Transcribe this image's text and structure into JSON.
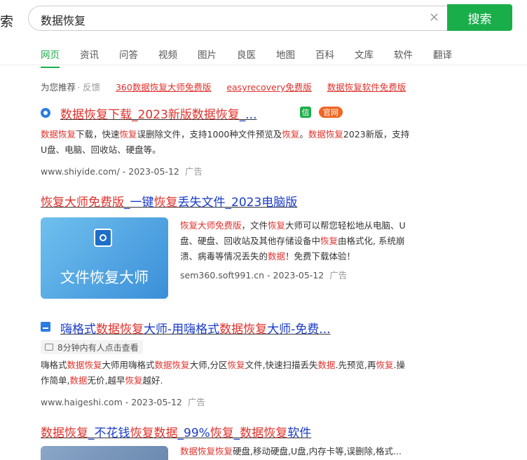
{
  "search": {
    "logo_char": "索",
    "query": "数据恢复",
    "clear_symbol": "×",
    "button_label": "搜索"
  },
  "tabs": [
    "网页",
    "资讯",
    "问答",
    "视频",
    "图片",
    "良医",
    "地图",
    "百科",
    "文库",
    "软件",
    "翻译"
  ],
  "recommend": {
    "label": "为您推荐",
    "feedback": "· 反馈",
    "links": [
      "360数据恢复大师免费版",
      "easyrecovery免费版",
      "数据恢复软件免费版"
    ]
  },
  "results": [
    {
      "title_red": "数据恢复下载_2023新版",
      "title_red2": "数据恢复",
      "title_tail": "_...",
      "badge_xin": "信",
      "badge_official": "官网",
      "snippet_line1_a": "数据恢复",
      "snippet_line1_b": "下载，快速",
      "snippet_line1_c": "恢复",
      "snippet_line1_d": "误删除文件，支持1000种文件预览及",
      "snippet_line1_e": "恢复",
      "snippet_line1_f": "。",
      "snippet_line1_g": "数据恢复",
      "snippet_line1_h": "2023新版，支持",
      "snippet_line2": "U盘、电脑、回收站、硬盘等。",
      "url": "www.shiyide.com/ - 2023-05-12",
      "ad": "广告"
    },
    {
      "title_red": "恢复大师免费版",
      "title_mid": "_一键",
      "title_red2": "恢复",
      "title_tail": "丢失文件_2023电脑版",
      "thumb_text": "文件恢复大师",
      "snippet_l1_a": "恢复大师免费版",
      "snippet_l1_b": "，文件",
      "snippet_l1_c": "恢复",
      "snippet_l1_d": "大师可以帮您轻松地从电脑、U",
      "snippet_l2_a": "盘、硬盘、回收站及其他存储设备中",
      "snippet_l2_b": "恢复",
      "snippet_l2_c": "由格式化, 系统崩",
      "snippet_l3_a": "溃、病毒等情况丢失的",
      "snippet_l3_b": "数据",
      "snippet_l3_c": "！免费下载体验！",
      "url": "sem360.soft991.cn - 2023-05-12",
      "ad": "广告"
    },
    {
      "title_a": "嗨格式",
      "title_red": "数据恢复",
      "title_b": "大师-用嗨格式",
      "title_red2": "数据恢复",
      "title_c": "大师-免费...",
      "clicks": "8分钟内有人点击查看",
      "s1_a": "嗨格式",
      "s1_b": "数据恢复",
      "s1_c": "大师用嗨格式",
      "s1_d": "数据恢复",
      "s1_e": "大师,分区",
      "s1_f": "恢复",
      "s1_g": "文件,快速扫描丢失",
      "s1_h": "数据",
      "s1_i": ".先预览,再",
      "s1_j": "恢复",
      "s1_k": ".操",
      "s2_a": "作简单,",
      "s2_b": "数据",
      "s2_c": "无价,越早",
      "s2_d": "恢复",
      "s2_e": "越好.",
      "url": "www.haigeshi.com - 2023-05-12",
      "ad": "广告"
    },
    {
      "title_red": "数据恢复",
      "title_a": "_不花钱",
      "title_red2": "恢复数据",
      "title_b": "_99%",
      "title_red3": "恢复",
      "title_c": "_",
      "title_red4": "数据恢复",
      "title_d": "软件",
      "snippet_red": "数据恢复恢复",
      "snippet_rest": "硬盘,移动硬盘,U盘,内存卡等,误删除,格式..."
    }
  ],
  "colors": {
    "accent": "#1aae4a",
    "keyword": "#e0322c",
    "link": "#1a3bc8"
  }
}
